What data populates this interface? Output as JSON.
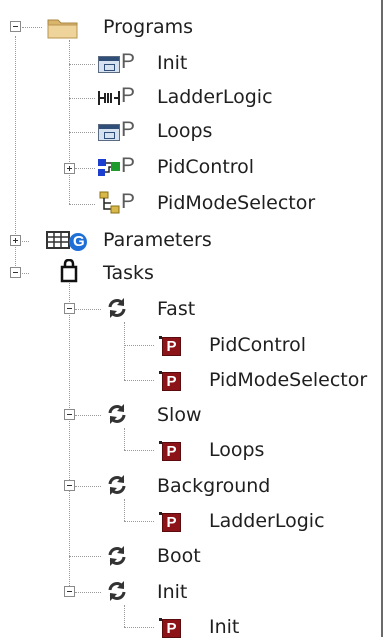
{
  "tree": {
    "programs": {
      "label": "Programs",
      "children": {
        "init": "Init",
        "ladder_logic": "LadderLogic",
        "loops": "Loops",
        "pid_control": "PidControl",
        "pid_mode_selector": "PidModeSelector"
      },
      "program_letter": "P"
    },
    "parameters": {
      "label": "Parameters",
      "badge": "G"
    },
    "tasks": {
      "label": "Tasks",
      "fast": {
        "label": "Fast",
        "children": [
          "PidControl",
          "PidModeSelector"
        ]
      },
      "slow": {
        "label": "Slow",
        "children": [
          "Loops"
        ]
      },
      "background": {
        "label": "Background",
        "children": [
          "LadderLogic"
        ]
      },
      "boot": {
        "label": "Boot"
      },
      "init": {
        "label": "Init",
        "children": [
          "Init"
        ]
      },
      "program_badge": "P"
    }
  },
  "colors": {
    "badge_red": "#8c1418",
    "folder": "#e8c98a",
    "parameters_blue": "#1e6fd6",
    "task_icon": "#333333"
  },
  "icons": {
    "folder": "folder-icon",
    "program": "program-icon",
    "ladder": "ladder-icon",
    "function_block": "function-block-icon",
    "sfc": "sfc-icon",
    "parameters": "parameters-grid-icon",
    "tasks": "tasks-bag-icon",
    "task": "task-cycle-icon",
    "program_ref": "program-badge-icon"
  }
}
